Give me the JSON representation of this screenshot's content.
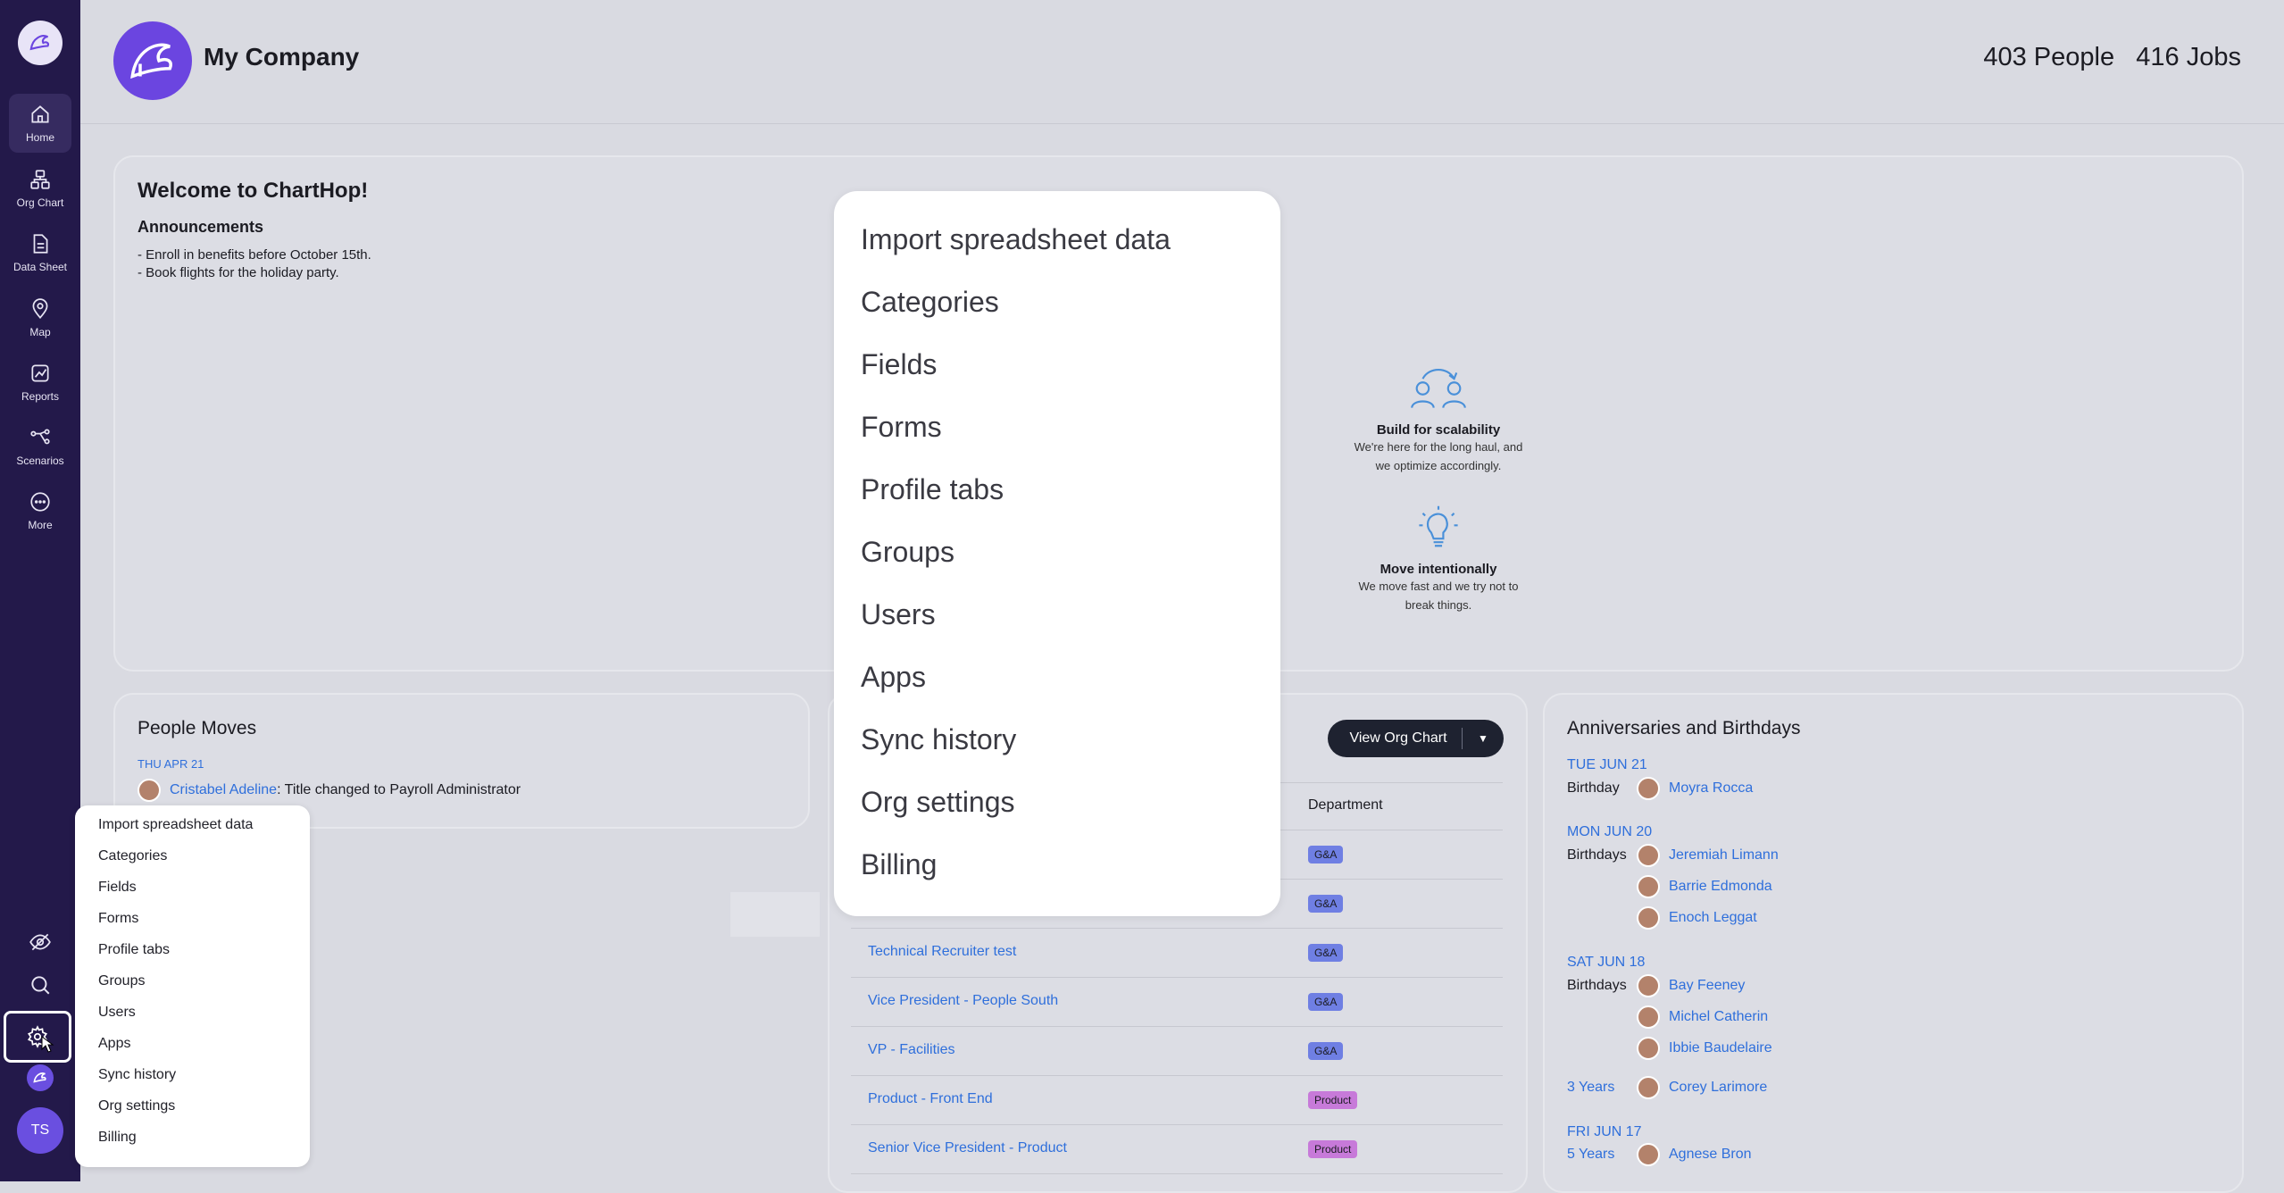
{
  "company": {
    "name": "My Company"
  },
  "stats": {
    "people_count": "403",
    "people_label": "People",
    "jobs_count": "416",
    "jobs_label": "Jobs"
  },
  "sidebar": {
    "items": [
      {
        "label": "Home",
        "icon": "home-icon"
      },
      {
        "label": "Org Chart",
        "icon": "org-chart-icon"
      },
      {
        "label": "Data Sheet",
        "icon": "document-icon"
      },
      {
        "label": "Map",
        "icon": "map-pin-icon"
      },
      {
        "label": "Reports",
        "icon": "chart-icon"
      },
      {
        "label": "Scenarios",
        "icon": "scenarios-icon"
      },
      {
        "label": "More",
        "icon": "more-icon"
      }
    ],
    "avatar_initials": "TS"
  },
  "welcome": {
    "title": "Welcome to ChartHop!",
    "announcements_title": "Announcements",
    "announcements": [
      "- Enroll in benefits before October 15th.",
      "- Book flights for the holiday party."
    ],
    "values": [
      {
        "title": "Build for scalability",
        "line1": "We're here for the long haul, and",
        "line2": "we optimize accordingly."
      },
      {
        "title": "Move intentionally",
        "line1": "We move fast and we try not to",
        "line2": "break things."
      }
    ]
  },
  "people_moves": {
    "title": "People Moves",
    "date": "THU APR 21",
    "person": "Cristabel Adeline",
    "change": ": Title changed to Payroll Administrator"
  },
  "jobs": {
    "view_button": "View Org Chart",
    "department_header": "Department",
    "rows": [
      {
        "name": "",
        "dept": "G&A"
      },
      {
        "name": "",
        "dept": "G&A"
      },
      {
        "name": "Technical Recruiter test",
        "dept": "G&A"
      },
      {
        "name": "Vice President - People South",
        "dept": "G&A"
      },
      {
        "name": "VP - Facilities",
        "dept": "G&A"
      },
      {
        "name": "Product - Front End",
        "dept": "Product"
      },
      {
        "name": "Senior Vice President - Product",
        "dept": "Product"
      }
    ]
  },
  "anniversaries": {
    "title": "Anniversaries and Birthdays",
    "date1": "TUE JUN 21",
    "birthday_label": "Birthday",
    "p1": "Moyra Rocca",
    "date2": "MON JUN 20",
    "birthdays_label": "Birthdays",
    "p2": "Jeremiah Limann",
    "p3": "Barrie Edmonda",
    "p4": "Enoch Leggat",
    "date3": "SAT JUN 18",
    "p5": "Bay Feeney",
    "p6": "Michel Catherin",
    "p7": "Ibbie Baudelaire",
    "years1": "3 Years",
    "p8": "Corey Larimore",
    "date4": "FRI JUN 17",
    "years2": "5 Years",
    "p9": "Agnese Bron"
  },
  "settings_menu": {
    "items": [
      "Import spreadsheet data",
      "Categories",
      "Fields",
      "Forms",
      "Profile tabs",
      "Groups",
      "Users",
      "Apps",
      "Sync history",
      "Org settings",
      "Billing"
    ]
  },
  "colors": {
    "sidebar": "#23194a",
    "accent": "#6b45e0",
    "link": "#2f6fdb"
  }
}
